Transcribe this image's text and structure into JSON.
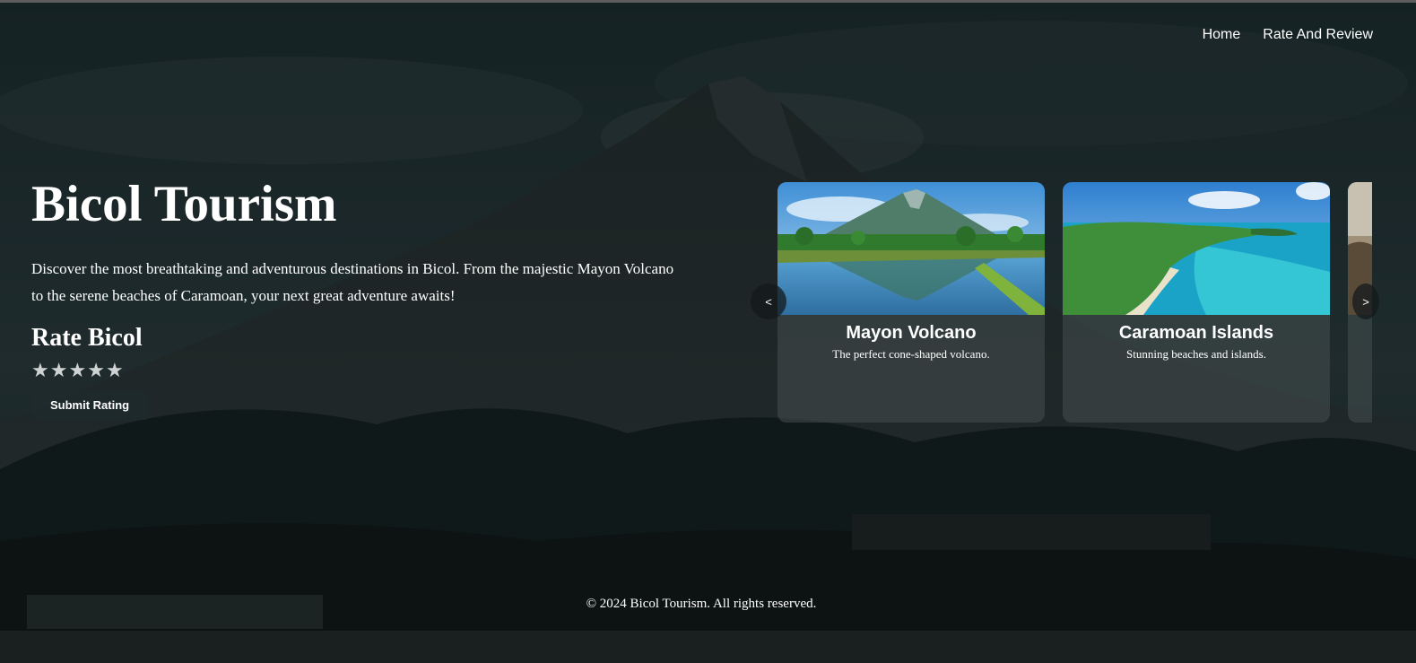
{
  "nav": {
    "home": "Home",
    "rate_review": "Rate And Review"
  },
  "hero": {
    "title": "Bicol Tourism",
    "description": "Discover the most breathtaking and adventurous destinations in Bicol. From the majestic Mayon Volcano to the serene beaches of Caramoan, your next great adventure awaits!",
    "rate_heading": "Rate Bicol",
    "stars": [
      "★",
      "★",
      "★",
      "★",
      "★"
    ],
    "submit_label": "Submit Rating"
  },
  "carousel": {
    "prev_label": "<",
    "next_label": ">",
    "cards": [
      {
        "name": "Mayon Volcano",
        "description": "The perfect cone-shaped volcano."
      },
      {
        "name": "Caramoan Islands",
        "description": "Stunning beaches and islands."
      }
    ]
  },
  "footer": {
    "copyright": "© 2024 Bicol Tourism. All rights reserved."
  },
  "colors": {
    "overlay": "#0f1a1c",
    "text": "#ffffff",
    "card_bg": "#464e50",
    "star": "#cfd2d3"
  }
}
